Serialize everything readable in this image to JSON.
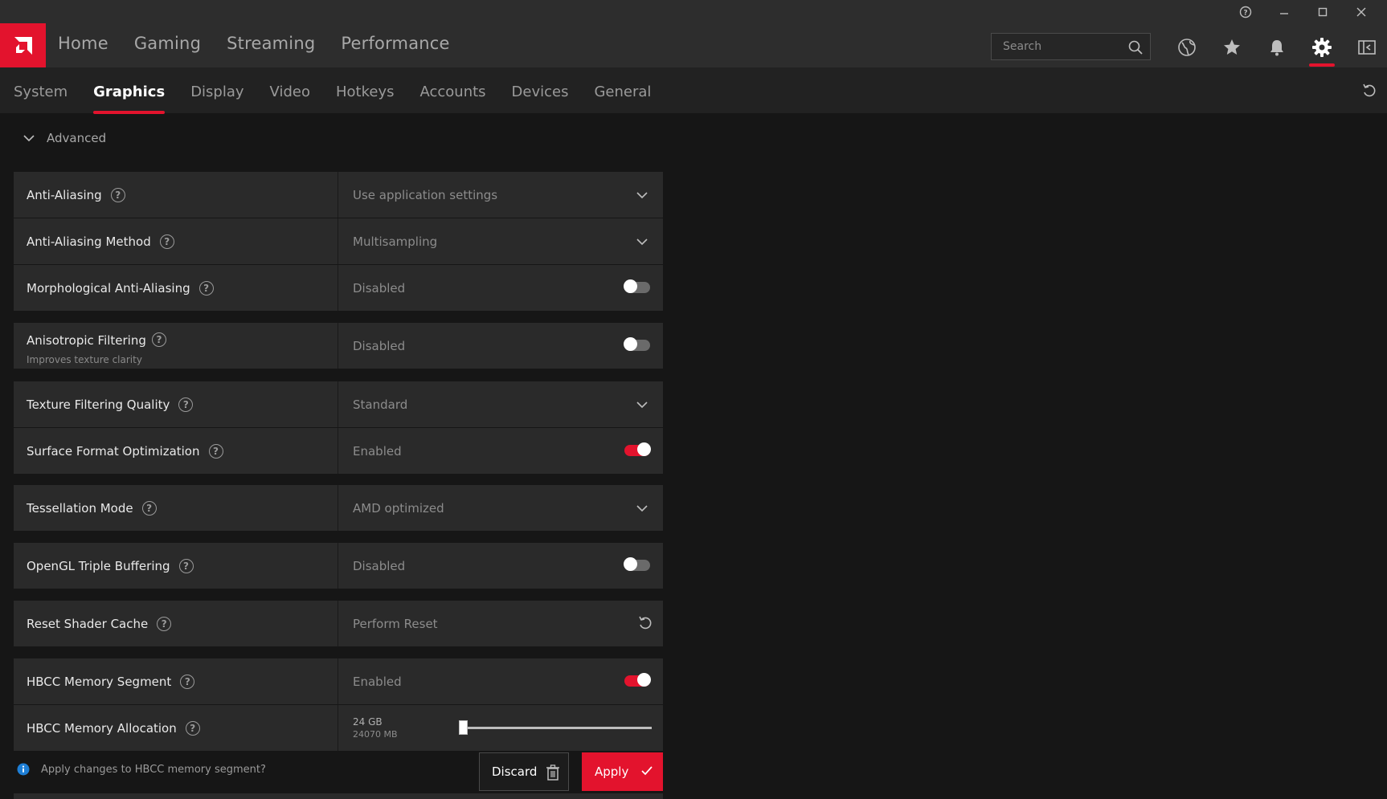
{
  "header": {
    "nav": [
      "Home",
      "Gaming",
      "Streaming",
      "Performance"
    ],
    "search_placeholder": "Search",
    "icons": [
      "globe-icon",
      "star-icon",
      "bell-icon",
      "gear-icon",
      "panel-collapse-icon"
    ],
    "active_icon": "gear-icon",
    "window_controls": [
      "help-icon",
      "minimize-icon",
      "maximize-icon",
      "close-icon"
    ]
  },
  "subnav": {
    "tabs": [
      "System",
      "Graphics",
      "Display",
      "Video",
      "Hotkeys",
      "Accounts",
      "Devices",
      "General"
    ],
    "active": "Graphics"
  },
  "section": {
    "title": "Advanced",
    "expanded": true
  },
  "settings": [
    {
      "label": "Anti-Aliasing",
      "value": "Use application settings",
      "control": "dropdown"
    },
    {
      "label": "Anti-Aliasing Method",
      "value": "Multisampling",
      "control": "dropdown"
    },
    {
      "label": "Morphological Anti-Aliasing",
      "value": "Disabled",
      "control": "toggle",
      "on": false
    },
    {
      "label": "Anisotropic Filtering",
      "sublabel": "Improves texture clarity",
      "value": "Disabled",
      "control": "toggle",
      "on": false
    },
    {
      "label": "Texture Filtering Quality",
      "value": "Standard",
      "control": "dropdown"
    },
    {
      "label": "Surface Format Optimization",
      "value": "Enabled",
      "control": "toggle",
      "on": true
    },
    {
      "label": "Tessellation Mode",
      "value": "AMD optimized",
      "control": "dropdown"
    },
    {
      "label": "OpenGL Triple Buffering",
      "value": "Disabled",
      "control": "toggle",
      "on": false
    },
    {
      "label": "Reset Shader Cache",
      "value": "Perform Reset",
      "control": "reset"
    },
    {
      "label": "HBCC Memory Segment",
      "value": "Enabled",
      "control": "toggle",
      "on": true
    },
    {
      "label": "HBCC Memory Allocation",
      "value": "24 GB",
      "value_detail": "24070 MB",
      "control": "slider",
      "slider_fraction": 0.0
    }
  ],
  "prompt": {
    "message": "Apply changes to HBCC memory segment?",
    "discard_label": "Discard",
    "apply_label": "Apply"
  },
  "colors": {
    "accent": "#e3132d",
    "background": "#161616",
    "panel": "#2a2a2a",
    "header": "#2d2d2d"
  }
}
